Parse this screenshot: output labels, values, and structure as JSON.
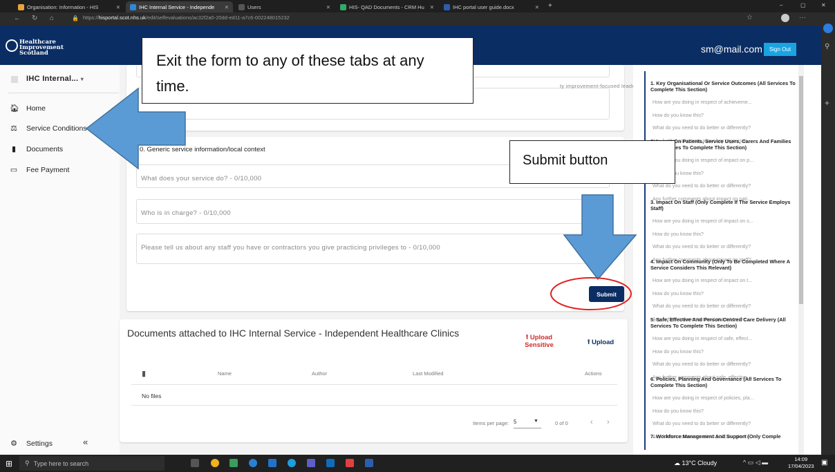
{
  "browser": {
    "tabs": [
      {
        "label": "Organisation: Information - HIS",
        "fav": "#e8a33b"
      },
      {
        "label": "IHC Internal Service - Independe",
        "fav": "#2f87d8"
      },
      {
        "label": "Users",
        "fav": "#555"
      },
      {
        "label": "HIS- QAD Documents - CRM Hu",
        "fav": "#3a6"
      },
      {
        "label": "IHC portal user guide.docx",
        "fav": "#2b5fad"
      }
    ],
    "url_prefix": "https://",
    "url_host": "hisportal.scot.nhs.uk",
    "url_path": "/edit/selfevaluations/ac32f2a0-20dd-ed11-a7c6-002248015232"
  },
  "header": {
    "logo_line1": "Healthcare",
    "logo_line2": "Improvement",
    "logo_line3": "Scotland",
    "user_email": "sm@mail.com",
    "signout_label": "Sign Out"
  },
  "sidebar": {
    "org_name": "IHC Internal...",
    "items": [
      {
        "label": "Home",
        "icon": "home-icon"
      },
      {
        "label": "Service Conditions",
        "icon": "gavel-icon"
      },
      {
        "label": "Documents",
        "icon": "document-icon"
      },
      {
        "label": "Fee Payment",
        "icon": "credit-card-icon"
      }
    ],
    "settings_label": "Settings",
    "collapse_label": "«"
  },
  "form": {
    "top_field_placeholder": "ty improvement-focused leadership?",
    "section_title": "0. Generic service information/local context",
    "fields": [
      "What does your service do? - 0/10,000",
      "Who is in charge? - 0/10,000",
      "Please tell us about any staff you have or contractors you give practicing privileges to - 0/10,000"
    ],
    "submit_label": "Submit"
  },
  "documents": {
    "title": "Documents attached to IHC Internal Service - Independent Healthcare Clinics",
    "upload_sensitive_label": "Upload Sensitive",
    "upload_label": "Upload",
    "columns": [
      "Name",
      "Author",
      "Last Modified",
      "Actions"
    ],
    "empty_text": "No files",
    "items_per_page_label": "Items per page:",
    "items_per_page_value": "5",
    "range_text": "0 of 0"
  },
  "right_panel": {
    "sections": [
      {
        "title": "1. Key Organisational Or Service Outcomes (All Services To Complete This Section)",
        "questions": [
          "How are you doing in respect of achieveme...",
          "How do you know this?",
          "What do you need to do better or differently?",
          "Any further comments about key organisati..."
        ]
      },
      {
        "title": "2. Impact On Patients, Service Users, Carers And Families (All Services To Complete This Section)",
        "questions": [
          "How are you doing in respect of impact on p...",
          "How do you know this?",
          "What do you need to do better or differently?",
          "Any further comments about impact on pati..."
        ]
      },
      {
        "title": "3. Impact On Staff (Only Complete If The Service Employs Staff)",
        "questions": [
          "How are you doing in respect of impact on s...",
          "How do you know this?",
          "What do you need to do better or differently?",
          "Any further comments about impact on staff?"
        ]
      },
      {
        "title": "4. Impact On Community (Only To Be Completed Where A Service Considers This Relevant)",
        "questions": [
          "How are you doing in respect of impact on t...",
          "How do you know this?",
          "What do you need to do better or differently?",
          "Any further comments about impact on the ..."
        ]
      },
      {
        "title": "5. Safe, Effective And Person-Centred Care Delivery (All Services To Complete This Section)",
        "questions": [
          "How are you doing in respect of safe, effect...",
          "How do you know this?",
          "What do you need to do better or differently?",
          "Any further comments about safe, effective,..."
        ]
      },
      {
        "title": "6. Policies, Planning And Governance (All Services To Complete This Section)",
        "questions": [
          "How are you doing in respect of policies, pla...",
          "How do you know this?",
          "What do you need to do better or differently?",
          "Any further comments about policies, planni..."
        ]
      },
      {
        "title": "7. Workforce Management And Support (Only Comple",
        "questions": []
      }
    ]
  },
  "annotations": {
    "exit_callout": "Exit the form to any of these tabs at any time.",
    "submit_callout": "Submit button"
  },
  "taskbar": {
    "search_placeholder": "Type here to search",
    "weather": "13°C  Cloudy",
    "time": "14:09",
    "date": "17/04/2023"
  }
}
